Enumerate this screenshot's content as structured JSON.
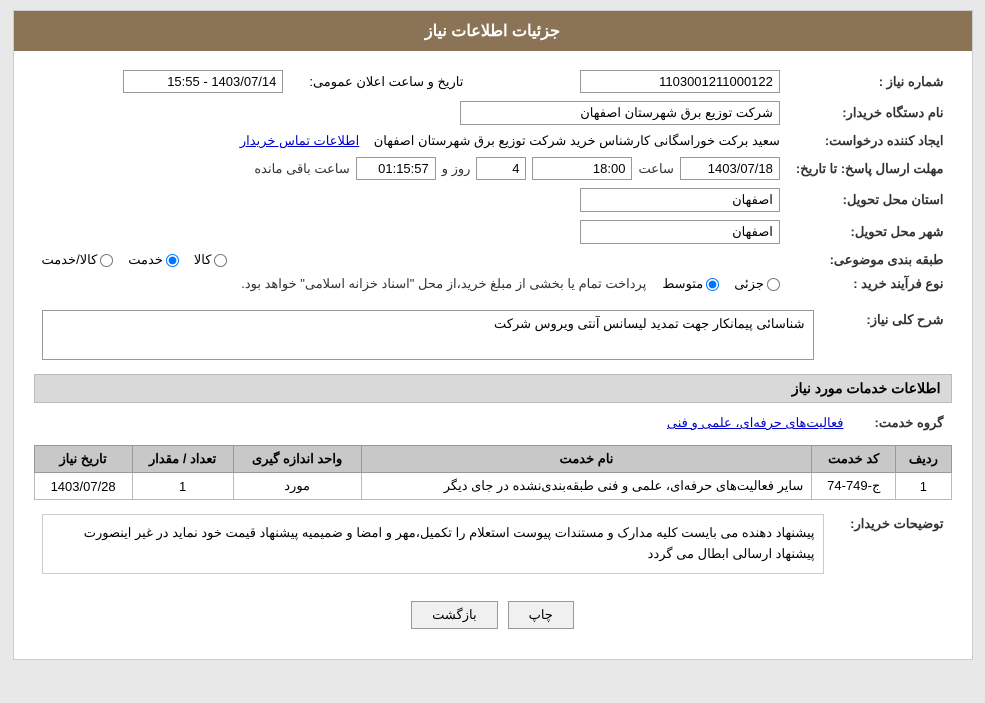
{
  "header": {
    "title": "جزئیات اطلاعات نیاز"
  },
  "fields": {
    "shomareNiaz_label": "شماره نیاز :",
    "shomareNiaz_value": "1103001211000122",
    "namDastgah_label": "نام دستگاه خریدار:",
    "namDastgah_value": "شرکت توزیع برق شهرستان اصفهان",
    "ijadKonande_label": "ایجاد کننده درخواست:",
    "ijadKonande_value": "سعید برکت خوراسگانی کارشناس خرید شرکت توزیع برق شهرستان اصفهان",
    "etelaat_link": "اطلاعات تماس خریدار",
    "mohlatErsalPasokh_label": "مهلت ارسال پاسخ: تا تاریخ:",
    "tarikhPasokh_value": "1403/07/18",
    "saatPasokh_label": "ساعت",
    "saatPasokh_value": "18:00",
    "rozMande_label": "روز و",
    "rozMande_value": "4",
    "saatMande_label": "ساعت باقی مانده",
    "saatMande_value": "01:15:57",
    "tarikhElan_label": "تاریخ و ساعت اعلان عمومی:",
    "tarikhElan_value": "1403/07/14 - 15:55",
    "ostanTahvil_label": "استان محل تحویل:",
    "ostanTahvil_value": "اصفهان",
    "shahrTahvil_label": "شهر محل تحویل:",
    "shahrTahvil_value": "اصفهان",
    "tabaqehBandi_label": "طبقه بندی موضوعی:",
    "tabaqehBandi_options": [
      {
        "label": "کالا",
        "value": "kala"
      },
      {
        "label": "خدمت",
        "value": "khedmat"
      },
      {
        "label": "کالا/خدمت",
        "value": "kala_khedmat"
      }
    ],
    "tabaqehBandi_selected": "khedmat",
    "noeFarayand_label": "نوع فرآیند خرید :",
    "noeFarayand_options": [
      {
        "label": "جزئی",
        "value": "jozi"
      },
      {
        "label": "متوسط",
        "value": "motavaset"
      }
    ],
    "noeFarayand_selected": "motavaset",
    "noeFarayand_note": "پرداخت تمام یا بخشی از مبلغ خرید،از محل \"اسناد خزانه اسلامی\" خواهد بود.",
    "sharhNiaz_label": "شرح کلی نیاز:",
    "sharhNiaz_value": "شناسائی پیمانکار جهت تمدید لیسانس آنتی ویروس شرکت",
    "khadamat_label": "اطلاعات خدمات مورد نیاز",
    "groupeKhedmat_label": "گروه خدمت:",
    "groupeKhedmat_value": "فعالیت‌های حرفه‌ای، علمی و فنی",
    "table": {
      "headers": [
        "ردیف",
        "کد خدمت",
        "نام خدمت",
        "واحد اندازه گیری",
        "تعداد / مقدار",
        "تاریخ نیاز"
      ],
      "rows": [
        {
          "radif": "1",
          "kodKhedmat": "ج-749-74",
          "namKhedmat": "سایر فعالیت‌های حرفه‌ای، علمی و فنی طبقه‌بندی‌نشده در جای دیگر",
          "vahed": "مورد",
          "tedadMeqdar": "1",
          "tarikhNiaz": "1403/07/28"
        }
      ]
    },
    "tosihKharidar_label": "توضیحات خریدار:",
    "tosihKharidar_value": "پیشنهاد دهنده می بایست کلیه مدارک و مستندات پیوست استعلام را تکمیل،مهر و امضا و ضمیمیه پیشنهاد قیمت خود نماید در غیر اینصورت پیشنهاد ارسالی ابطال می گردد"
  },
  "buttons": {
    "print_label": "چاپ",
    "back_label": "بازگشت"
  }
}
